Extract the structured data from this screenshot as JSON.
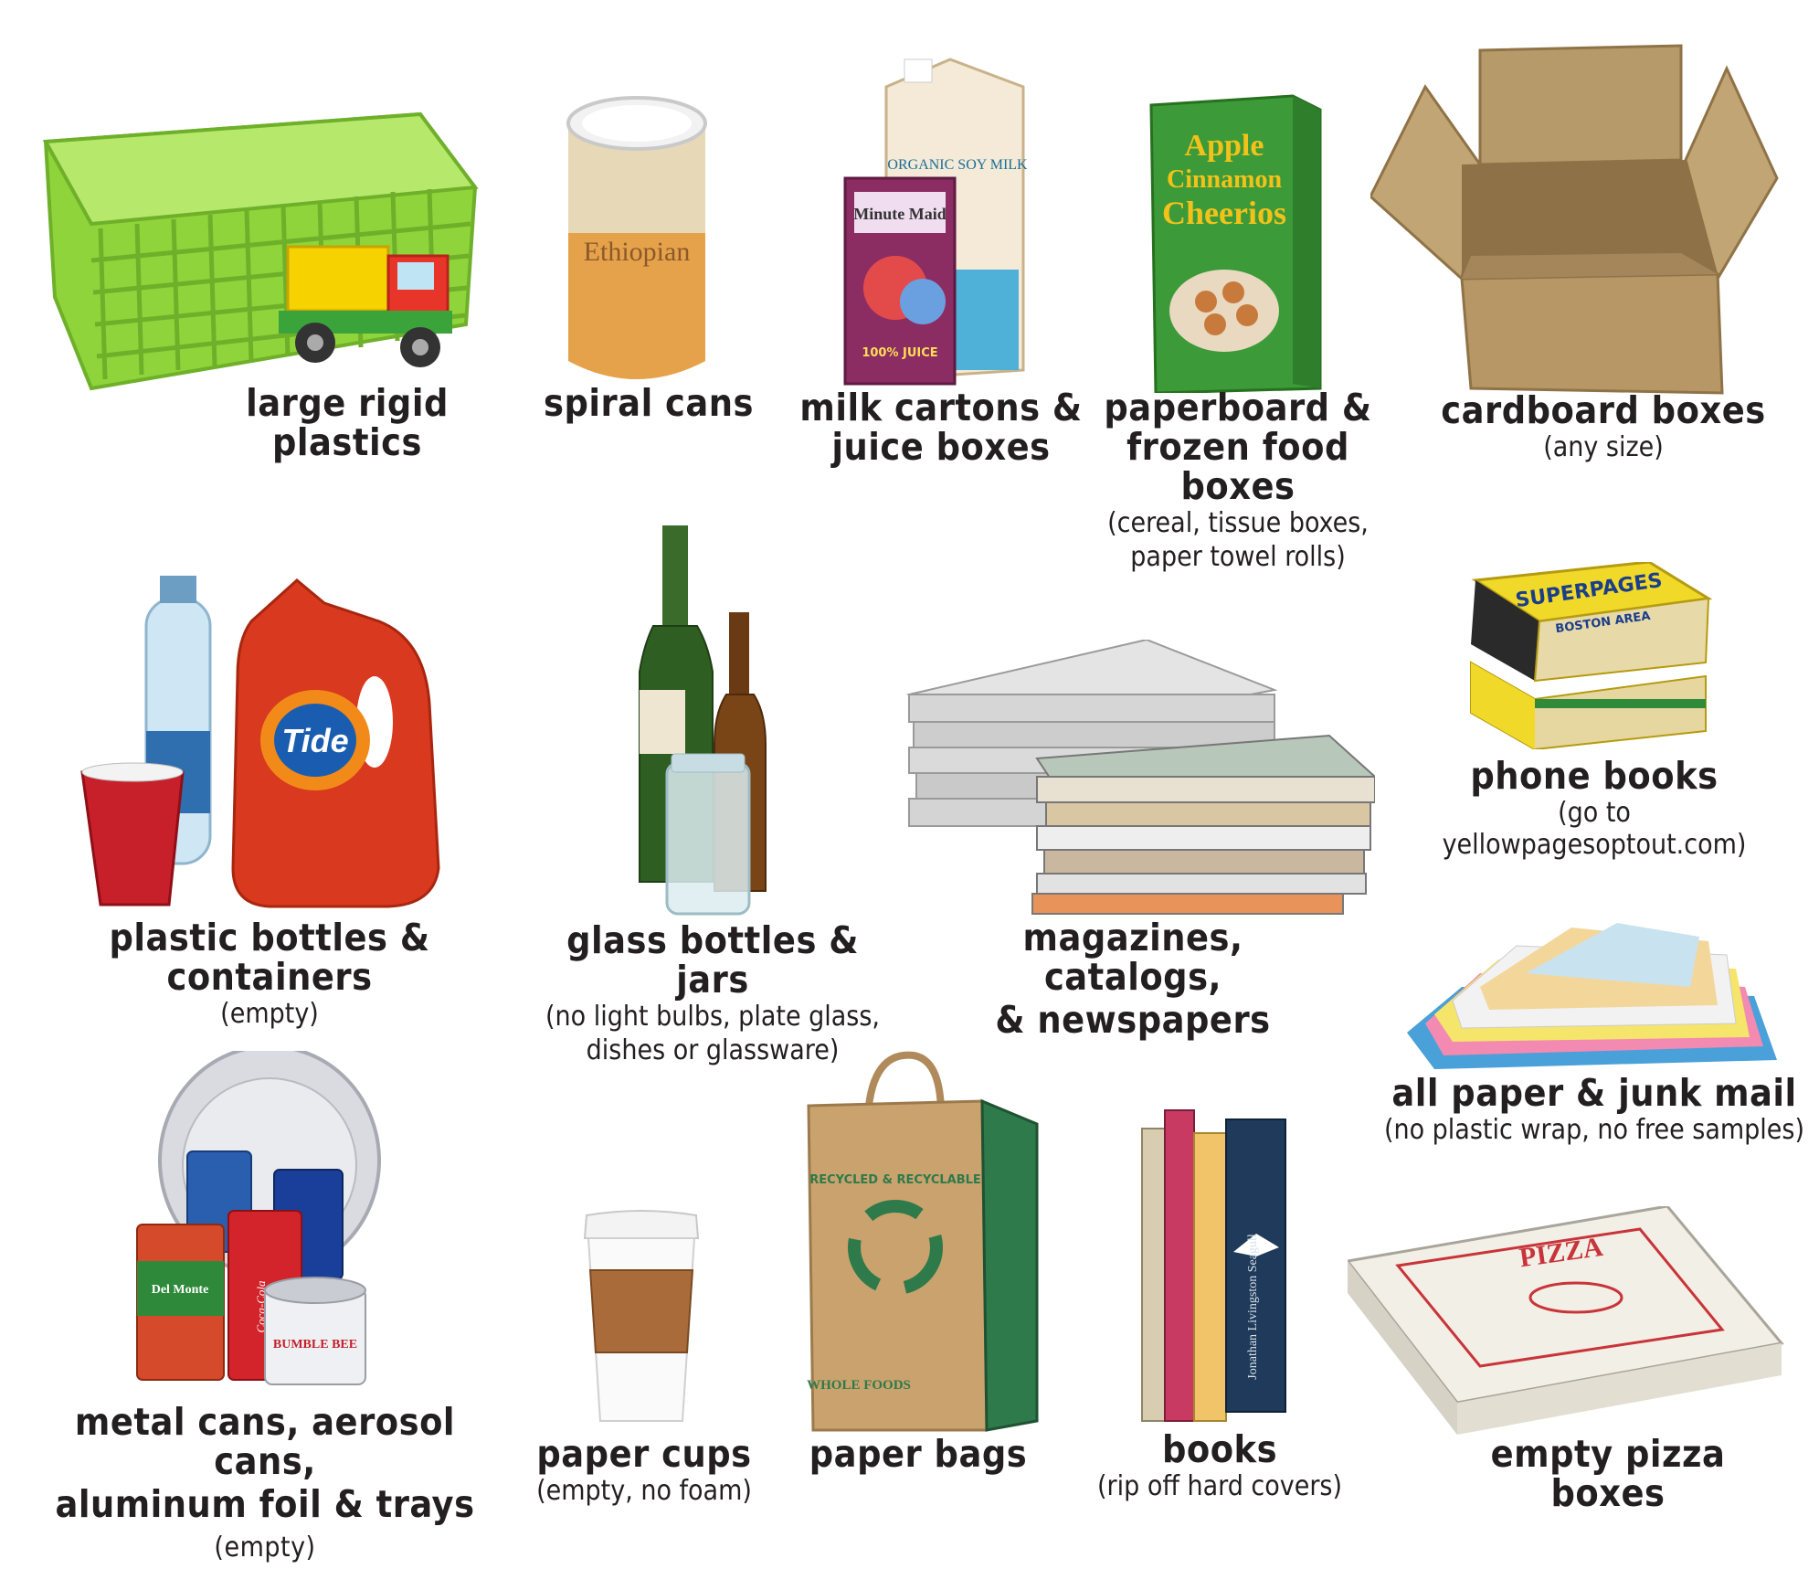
{
  "colors": {
    "text": "#231f20",
    "background": "#ffffff"
  },
  "items": {
    "rigid_plastics": {
      "title": "large rigid plastics",
      "icon": "basket-with-toy-truck"
    },
    "spiral_cans": {
      "title": "spiral cans",
      "icon": "spiral-can",
      "label_text": "Ethiopian"
    },
    "cartons": {
      "title_line1": "milk cartons &",
      "title_line2": "juice boxes",
      "icon": "milk-carton-juice-box",
      "carton_text": "ORGANIC SOY MILK",
      "juice_text": "Minute Maid",
      "juice_label": "100% JUICE"
    },
    "paperboard": {
      "title_line1": "paperboard &",
      "title_line2": "frozen food boxes",
      "sub_line1": "(cereal, tissue boxes,",
      "sub_line2": "paper towel rolls)",
      "icon": "cereal-box",
      "box_text_1": "Apple",
      "box_text_2": "Cinnamon",
      "box_text_3": "Cheerios"
    },
    "cardboard": {
      "title": "cardboard boxes",
      "sub": "(any size)",
      "icon": "open-cardboard-box"
    },
    "plastic_bottles": {
      "title": "plastic bottles & containers",
      "sub": "(empty)",
      "icon": "detergent-bottle",
      "brand_text": "Tide"
    },
    "glass": {
      "title": "glass bottles & jars",
      "sub_line1": "(no light bulbs, plate glass,",
      "sub_line2": "dishes or glassware)",
      "icon": "glass-bottles-jar"
    },
    "magazines": {
      "title_line1": "magazines, catalogs,",
      "title_line2": "& newspapers",
      "icon": "newspaper-stack"
    },
    "phone_books": {
      "title": "phone books",
      "sub": "(go to yellowpagesoptout.com)",
      "icon": "phone-books",
      "book_text": "SUPERPAGES",
      "book_sub": "BOSTON AREA"
    },
    "junk_mail": {
      "title": "all paper & junk mail",
      "sub": "(no plastic wrap, no free samples)",
      "icon": "paper-pile"
    },
    "metal_cans": {
      "title_line1": "metal cans, aerosol cans,",
      "title_line2": "aluminum foil & trays",
      "title_suffix": "(empty)",
      "icon": "metal-cans-tray",
      "can_text_1": "Del Monte",
      "can_text_2": "Coca-Cola",
      "can_text_3": "BUMBLE BEE"
    },
    "paper_cups": {
      "title": "paper cups",
      "sub": "(empty, no foam)",
      "icon": "paper-coffee-cup"
    },
    "paper_bags": {
      "title": "paper bags",
      "icon": "paper-grocery-bag",
      "bag_text_1": "RECYCLED & RECYCLABLE",
      "bag_text_2": "WHOLE FOODS"
    },
    "books": {
      "title": "books",
      "sub": "(rip off  hard covers)",
      "icon": "book-stack",
      "book_text": "Jonathan Livingston Seagull"
    },
    "pizza": {
      "title": "empty pizza boxes",
      "icon": "pizza-box",
      "box_text": "PIZZA"
    }
  }
}
